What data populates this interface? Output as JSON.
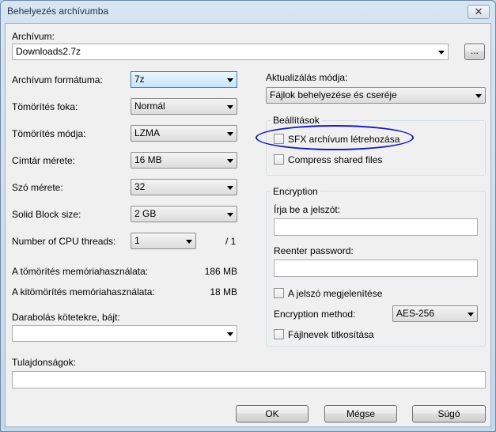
{
  "window": {
    "title": "Behelyezés archívumba",
    "close_glyph": "✕"
  },
  "archive": {
    "label": "Archívum:",
    "value": "Downloads2.7z",
    "browse_label": "..."
  },
  "left": {
    "format": {
      "label": "Archívum formátuma:",
      "value": "7z"
    },
    "level": {
      "label": "Tömörítés foka:",
      "value": "Normál"
    },
    "method": {
      "label": "Tömörítés módja:",
      "value": "LZMA"
    },
    "dict": {
      "label": "Címtár mérete:",
      "value": "16 MB"
    },
    "word": {
      "label": "Szó mérete:",
      "value": "32"
    },
    "solid": {
      "label": "Solid Block size:",
      "value": "2 GB"
    },
    "threads": {
      "label": "Number of CPU threads:",
      "value": "1",
      "max": "/ 1"
    },
    "mem_compress": {
      "label": "A tömörítés memóriahasználata:",
      "value": "186 MB"
    },
    "mem_decompress": {
      "label": "A kitömörítés memóriahasználata:",
      "value": "18 MB"
    },
    "split": {
      "label": "Darabolás kötetekre, bájt:",
      "value": ""
    },
    "params": {
      "label": "Tulajdonságok:",
      "value": ""
    }
  },
  "right": {
    "update_mode": {
      "label": "Aktualizálás módja:",
      "value": "Fájlok behelyezése és cseréje"
    },
    "options": {
      "title": "Beállítások",
      "sfx": "SFX archívum létrehozása",
      "shared": "Compress shared files"
    },
    "encryption": {
      "title": "Encryption",
      "password_label": "Írja be a jelszót:",
      "reenter_label": "Reenter password:",
      "show_password": "A jelszó megjelenítése",
      "method_label": "Encryption method:",
      "method_value": "AES-256",
      "encrypt_names": "Fájlnevek titkosítása"
    }
  },
  "buttons": {
    "ok": "OK",
    "cancel": "Mégse",
    "help": "Súgó"
  }
}
